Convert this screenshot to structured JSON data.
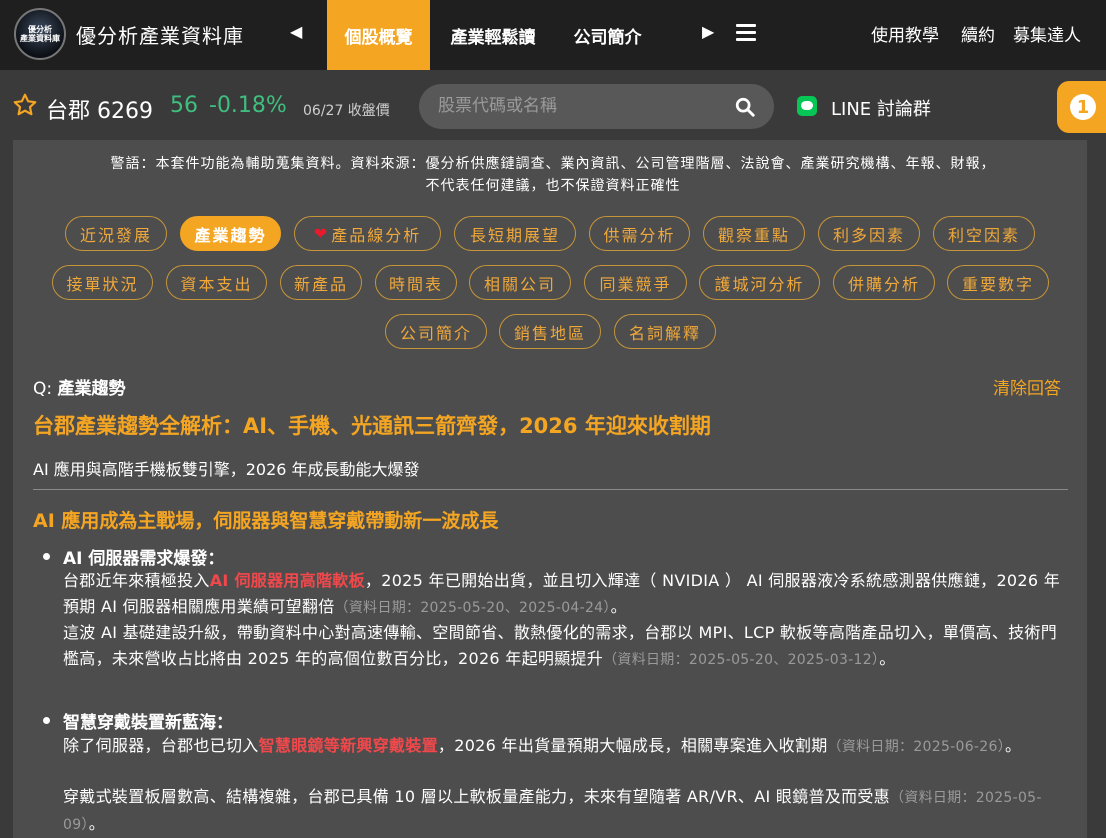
{
  "logo": {
    "line1": "優分析",
    "line2": "產業資料庫"
  },
  "site_title": "優分析產業資料庫",
  "nav": {
    "prev_arrow": "◀",
    "next_arrow": "▶",
    "tabs": [
      {
        "label": "個股概覽",
        "active": true
      },
      {
        "label": "產業輕鬆讀",
        "active": false
      },
      {
        "label": "公司簡介",
        "active": false
      }
    ],
    "right_links": [
      "使用教學",
      "續約",
      "募集達人"
    ]
  },
  "stock": {
    "name_code": "台郡 6269",
    "price": "56",
    "change": "-0.18%",
    "date_label": "06/27 收盤價",
    "price_color": "#3fbf7f"
  },
  "search": {
    "placeholder": "股票代碼或名稱"
  },
  "line_group": {
    "label": "LINE 討論群"
  },
  "notification": {
    "count": "1"
  },
  "warning": {
    "line1": "警語：本套件功能為輔助蒐集資料。資料來源：優分析供應鏈調查、業內資訊、公司管理階層、法說會、產業研究機構、年報、財報，",
    "line2": "不代表任何建議，也不保證資料正確性"
  },
  "tags": [
    "近況發展",
    "產業趨勢",
    "產品線分析",
    "長短期展望",
    "供需分析",
    "觀察重點",
    "利多因素",
    "利空因素",
    "接單狀況",
    "資本支出",
    "新產品",
    "時間表",
    "相關公司",
    "同業競爭",
    "護城河分析",
    "併購分析",
    "重要數字",
    "公司簡介",
    "銷售地區",
    "名詞解釋"
  ],
  "question": {
    "prefix": "Q: ",
    "topic": "產業趨勢",
    "clear_label": "清除回答"
  },
  "article": {
    "title": "台郡產業趨勢全解析：AI、手機、光通訊三箭齊發，2026 年迎來收割期",
    "subtitle": "AI 應用與高階手機板雙引擎，2026 年成長動能大爆發",
    "section_title": "AI 應用成為主戰場，伺服器與智慧穿戴帶動新一波成長",
    "bullets": [
      {
        "heading": "AI 伺服器需求爆發：",
        "p1_pre": "台郡近年來積極投入",
        "p1_hl": "AI 伺服器用高階軟板",
        "p1_post": "，2025 年已開始出貨，並且切入輝達（ NVIDIA ） AI 伺服器液冷系統感測器供應鏈，2026 年預期 AI 伺服器相關應用業績可望翻倍",
        "p1_src": "（資料日期：2025-05-20、2025-04-24）",
        "p1_end": "。",
        "p2_pre": "這波 AI 基礎建設升級，帶動資料中心對高速傳輸、空間節省、散熱優化的需求，台郡以 MPI、LCP 軟板等高階產品切入，單價高、技術門檻高，未來營收占比將由 2025 年的高個位數百分比，2026 年起明顯提升",
        "p2_src": "（資料日期：2025-05-20、2025-03-12）",
        "p2_end": "。"
      },
      {
        "heading": "智慧穿戴裝置新藍海：",
        "p1_pre": "除了伺服器，台郡也已切入",
        "p1_hl": "智慧眼鏡等新興穿戴裝置",
        "p1_post": "，2026 年出貨量預期大幅成長，相關專案進入收割期",
        "p1_src": "（資料日期：2025-06-26）",
        "p1_end": "。",
        "p2_pre": "穿戴式裝置板層數高、結構複雜，台郡已具備 10 層以上軟板量產能力，未來有望隨著 AR/VR、AI 眼鏡普及而受惠",
        "p2_src": "（資料日期：2025-05-09）",
        "p2_end": "。"
      }
    ]
  },
  "colors": {
    "accent": "#f4a522",
    "highlight": "#f0484b",
    "positive": "#3fbf7f"
  }
}
